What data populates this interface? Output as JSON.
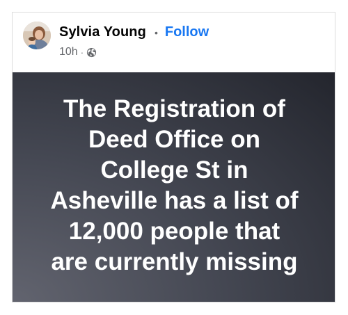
{
  "post": {
    "author": {
      "name": "Sylvia Young",
      "avatar_icon": "profile-photo"
    },
    "separator": "•",
    "follow_label": "Follow",
    "timestamp": "10h",
    "meta_separator": "·",
    "audience_icon": "globe-icon",
    "text_lines": [
      "The Registration of",
      "Deed Office on",
      "College St in",
      "Asheville has a list of",
      "12,000 people that",
      "are currently missing"
    ],
    "colors": {
      "follow": "#1877f2",
      "author": "#050505",
      "meta": "#65676b",
      "background_light": "#62646f",
      "background_dark": "#23252d",
      "text": "#ffffff"
    }
  }
}
